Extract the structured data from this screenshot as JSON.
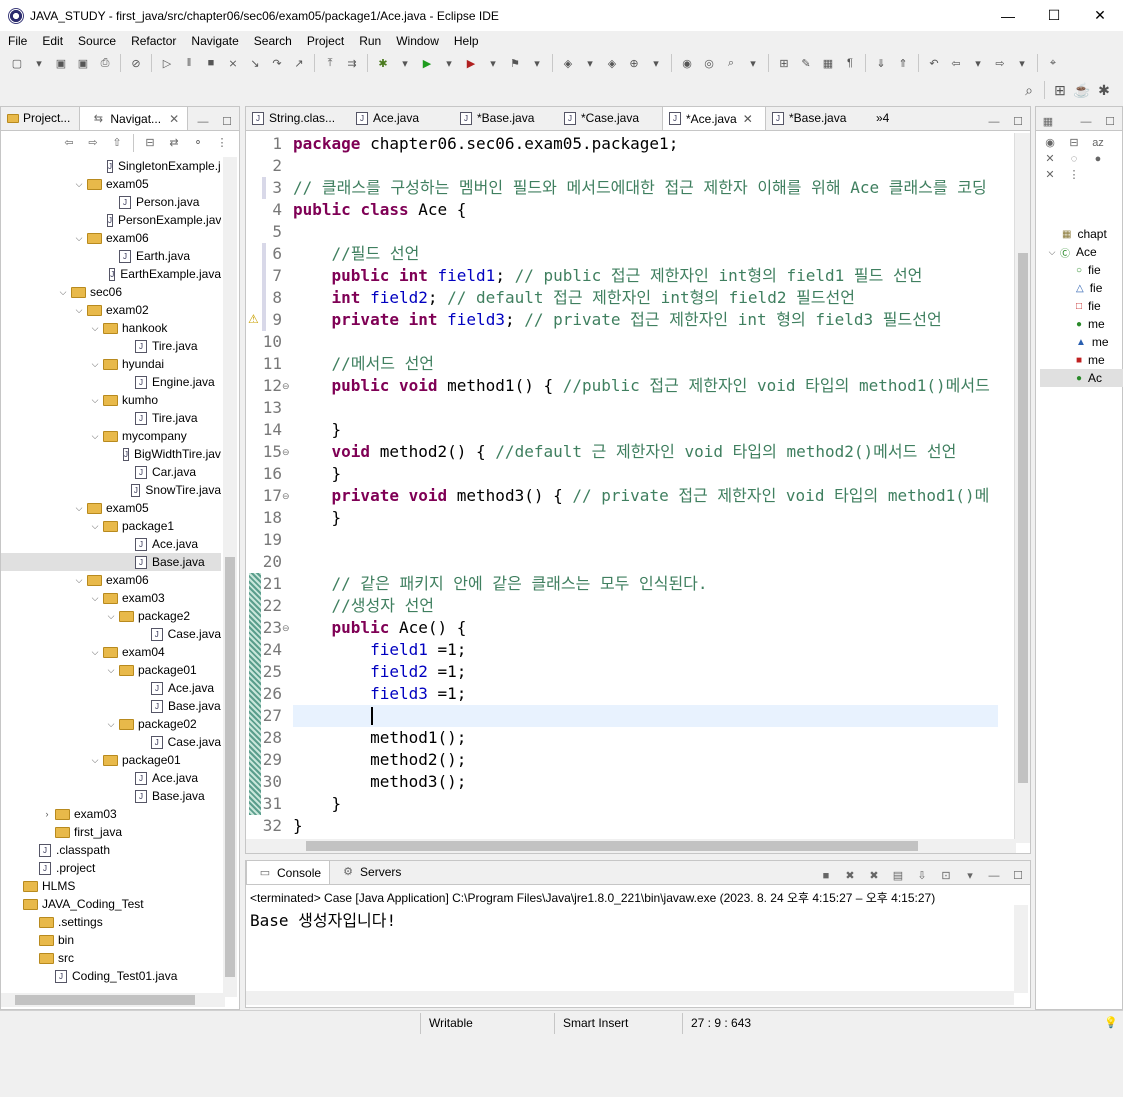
{
  "window": {
    "title": "JAVA_STUDY - first_java/src/chapter06/sec06/exam05/package1/Ace.java - Eclipse IDE",
    "minimize": "—",
    "maximize": "☐",
    "close": "✕"
  },
  "menu": [
    "File",
    "Edit",
    "Source",
    "Refactor",
    "Navigate",
    "Search",
    "Project",
    "Run",
    "Window",
    "Help"
  ],
  "left_panel": {
    "tabs": [
      {
        "label": "Project..."
      },
      {
        "label": "Navigat..."
      }
    ],
    "tree": [
      {
        "indent": 5,
        "type": "file",
        "label": "SingletonExample.java",
        "chevron": ""
      },
      {
        "indent": 3,
        "type": "folder",
        "label": "exam05",
        "chevron": "v"
      },
      {
        "indent": 5,
        "type": "file",
        "label": "Person.java",
        "chevron": ""
      },
      {
        "indent": 5,
        "type": "file",
        "label": "PersonExample.java",
        "chevron": ""
      },
      {
        "indent": 3,
        "type": "folder",
        "label": "exam06",
        "chevron": "v"
      },
      {
        "indent": 5,
        "type": "file",
        "label": "Earth.java",
        "chevron": ""
      },
      {
        "indent": 5,
        "type": "file",
        "label": "EarthExample.java",
        "chevron": ""
      },
      {
        "indent": 2,
        "type": "folder",
        "label": "sec06",
        "chevron": "v"
      },
      {
        "indent": 3,
        "type": "folder",
        "label": "exam02",
        "chevron": "v"
      },
      {
        "indent": 4,
        "type": "folder",
        "label": "hankook",
        "chevron": "v"
      },
      {
        "indent": 6,
        "type": "file",
        "label": "Tire.java",
        "chevron": ""
      },
      {
        "indent": 4,
        "type": "folder",
        "label": "hyundai",
        "chevron": "v"
      },
      {
        "indent": 6,
        "type": "file",
        "label": "Engine.java",
        "chevron": ""
      },
      {
        "indent": 4,
        "type": "folder",
        "label": "kumho",
        "chevron": "v"
      },
      {
        "indent": 6,
        "type": "file",
        "label": "Tire.java",
        "chevron": ""
      },
      {
        "indent": 4,
        "type": "folder",
        "label": "mycompany",
        "chevron": "v"
      },
      {
        "indent": 6,
        "type": "file",
        "label": "BigWidthTire.java",
        "chevron": ""
      },
      {
        "indent": 6,
        "type": "file",
        "label": "Car.java",
        "chevron": ""
      },
      {
        "indent": 6,
        "type": "file",
        "label": "SnowTire.java",
        "chevron": ""
      },
      {
        "indent": 3,
        "type": "folder",
        "label": "exam05",
        "chevron": "v"
      },
      {
        "indent": 4,
        "type": "folder",
        "label": "package1",
        "chevron": "v"
      },
      {
        "indent": 6,
        "type": "file",
        "label": "Ace.java",
        "chevron": ""
      },
      {
        "indent": 6,
        "type": "file",
        "label": "Base.java",
        "chevron": "",
        "selected": true
      },
      {
        "indent": 3,
        "type": "folder",
        "label": "exam06",
        "chevron": "v"
      },
      {
        "indent": 4,
        "type": "folder",
        "label": "exam03",
        "chevron": "v"
      },
      {
        "indent": 5,
        "type": "folder",
        "label": "package2",
        "chevron": "v"
      },
      {
        "indent": 7,
        "type": "file",
        "label": "Case.java",
        "chevron": ""
      },
      {
        "indent": 4,
        "type": "folder",
        "label": "exam04",
        "chevron": "v"
      },
      {
        "indent": 5,
        "type": "folder",
        "label": "package01",
        "chevron": "v"
      },
      {
        "indent": 7,
        "type": "file",
        "label": "Ace.java",
        "chevron": ""
      },
      {
        "indent": 7,
        "type": "file",
        "label": "Base.java",
        "chevron": ""
      },
      {
        "indent": 5,
        "type": "folder",
        "label": "package02",
        "chevron": "v"
      },
      {
        "indent": 7,
        "type": "file",
        "label": "Case.java",
        "chevron": ""
      },
      {
        "indent": 4,
        "type": "folder",
        "label": "package01",
        "chevron": "v"
      },
      {
        "indent": 6,
        "type": "file",
        "label": "Ace.java",
        "chevron": ""
      },
      {
        "indent": 6,
        "type": "file",
        "label": "Base.java",
        "chevron": ""
      },
      {
        "indent": 1,
        "type": "folder",
        "label": "exam03",
        "chevron": ">"
      },
      {
        "indent": 1,
        "type": "folder",
        "label": "first_java",
        "chevron": ""
      },
      {
        "indent": 0,
        "type": "file",
        "label": ".classpath",
        "chevron": ""
      },
      {
        "indent": 0,
        "type": "file",
        "label": ".project",
        "chevron": ""
      },
      {
        "indent": -1,
        "type": "folder",
        "label": "HLMS",
        "chevron": ""
      },
      {
        "indent": -1,
        "type": "folder",
        "label": "JAVA_Coding_Test",
        "chevron": ""
      },
      {
        "indent": 0,
        "type": "folder",
        "label": ".settings",
        "chevron": ""
      },
      {
        "indent": 0,
        "type": "folder",
        "label": "bin",
        "chevron": ""
      },
      {
        "indent": 0,
        "type": "folder",
        "label": "src",
        "chevron": ""
      },
      {
        "indent": 1,
        "type": "file",
        "label": "Coding_Test01.java",
        "chevron": ""
      }
    ]
  },
  "editor": {
    "tabs": [
      {
        "label": "String.clas..."
      },
      {
        "label": "Ace.java"
      },
      {
        "label": "*Base.java"
      },
      {
        "label": "*Case.java"
      },
      {
        "label": "*Ace.java",
        "active": true
      },
      {
        "label": "*Base.java"
      },
      {
        "label": "»4"
      }
    ],
    "lines": [
      [
        {
          "t": "package",
          "c": "kw"
        },
        {
          "t": " chapter06.sec06.exam05.package1;"
        }
      ],
      [],
      [
        {
          "t": "// 클래스를 구성하는 멤버인 필드와 메서드에대한 접근 제한자 이해를 위해 Ace 클래스를 코딩",
          "c": "cm"
        }
      ],
      [
        {
          "t": "public",
          "c": "kw"
        },
        {
          "t": " "
        },
        {
          "t": "class",
          "c": "kw"
        },
        {
          "t": " Ace {"
        }
      ],
      [],
      [
        {
          "t": "    //필드 선언",
          "c": "cm"
        }
      ],
      [
        {
          "t": "    "
        },
        {
          "t": "public",
          "c": "kw"
        },
        {
          "t": " "
        },
        {
          "t": "int",
          "c": "kw"
        },
        {
          "t": " "
        },
        {
          "t": "field1",
          "c": "fd"
        },
        {
          "t": "; "
        },
        {
          "t": "// public 접근 제한자인 int형의 field1 필드 선언",
          "c": "cm"
        }
      ],
      [
        {
          "t": "    "
        },
        {
          "t": "int",
          "c": "kw"
        },
        {
          "t": " "
        },
        {
          "t": "field2",
          "c": "fd"
        },
        {
          "t": "; "
        },
        {
          "t": "// default 접근 제한자인 int형의 field2 필드선언",
          "c": "cm"
        }
      ],
      [
        {
          "t": "    "
        },
        {
          "t": "private",
          "c": "kw"
        },
        {
          "t": " "
        },
        {
          "t": "int",
          "c": "kw"
        },
        {
          "t": " "
        },
        {
          "t": "field3",
          "c": "fd"
        },
        {
          "t": "; "
        },
        {
          "t": "// private 접근 제한자인 int 형의 field3 필드선언",
          "c": "cm"
        }
      ],
      [],
      [
        {
          "t": "    //메서드 선언",
          "c": "cm"
        }
      ],
      [
        {
          "t": "    "
        },
        {
          "t": "public",
          "c": "kw"
        },
        {
          "t": " "
        },
        {
          "t": "void",
          "c": "kw"
        },
        {
          "t": " method1() { "
        },
        {
          "t": "//public 접근 제한자인 void 타입의 method1()메서드",
          "c": "cm"
        }
      ],
      [],
      [
        {
          "t": "    }"
        }
      ],
      [
        {
          "t": "    "
        },
        {
          "t": "void",
          "c": "kw"
        },
        {
          "t": " method2() { "
        },
        {
          "t": "//default 근 제한자인 void 타입의 method2()메서드 선언",
          "c": "cm"
        }
      ],
      [
        {
          "t": "    }"
        }
      ],
      [
        {
          "t": "    "
        },
        {
          "t": "private",
          "c": "kw"
        },
        {
          "t": " "
        },
        {
          "t": "void",
          "c": "kw"
        },
        {
          "t": " method3() { "
        },
        {
          "t": "// private 접근 제한자인 void 타입의 method1()메",
          "c": "cm"
        }
      ],
      [
        {
          "t": "    }"
        }
      ],
      [],
      [],
      [
        {
          "t": "    // 같은 패키지 안에 같은 클래스는 모두 인식된다.",
          "c": "cm"
        }
      ],
      [
        {
          "t": "    //생성자 선언",
          "c": "cm"
        }
      ],
      [
        {
          "t": "    "
        },
        {
          "t": "public",
          "c": "kw"
        },
        {
          "t": " Ace() {"
        }
      ],
      [
        {
          "t": "        "
        },
        {
          "t": "field1",
          "c": "fd"
        },
        {
          "t": " =1;"
        }
      ],
      [
        {
          "t": "        "
        },
        {
          "t": "field2",
          "c": "fd"
        },
        {
          "t": " =1;"
        }
      ],
      [
        {
          "t": "        "
        },
        {
          "t": "field3",
          "c": "fd"
        },
        {
          "t": " =1;"
        }
      ],
      [],
      [
        {
          "t": "        method1();"
        }
      ],
      [
        {
          "t": "        method2();"
        }
      ],
      [
        {
          "t": "        method3();"
        }
      ],
      [
        {
          "t": "    }"
        }
      ],
      [
        {
          "t": "}"
        }
      ]
    ],
    "line_numbers": [
      "1",
      "2",
      "3",
      "4",
      "5",
      "6",
      "7",
      "8",
      "9",
      "10",
      "11",
      "12",
      "13",
      "14",
      "15",
      "16",
      "17",
      "18",
      "19",
      "20",
      "21",
      "22",
      "23",
      "24",
      "25",
      "26",
      "27",
      "28",
      "29",
      "30",
      "31",
      "32"
    ],
    "current_line": 27
  },
  "console": {
    "tabs": [
      {
        "label": "Console",
        "active": true
      },
      {
        "label": "Servers"
      }
    ],
    "header": "<terminated> Case [Java Application] C:\\Program Files\\Java\\jre1.8.0_221\\bin\\javaw.exe  (2023. 8. 24 오후 4:15:27 – 오후 4:15:27)",
    "output": "Base 생성자입니다!"
  },
  "outline": {
    "items": [
      {
        "label": "chapt",
        "icon": "package-icon"
      },
      {
        "label": "Ace",
        "icon": "class-icon"
      },
      {
        "label": "fie",
        "icon": "public-field-icon"
      },
      {
        "label": "fie",
        "icon": "default-field-icon"
      },
      {
        "label": "fie",
        "icon": "private-field-icon"
      },
      {
        "label": "me",
        "icon": "public-method-icon"
      },
      {
        "label": "me",
        "icon": "default-method-icon"
      },
      {
        "label": "me",
        "icon": "private-method-icon"
      },
      {
        "label": "Ac",
        "icon": "constructor-icon"
      }
    ]
  },
  "status": {
    "writable": "Writable",
    "insert": "Smart Insert",
    "position": "27 : 9 : 643"
  }
}
